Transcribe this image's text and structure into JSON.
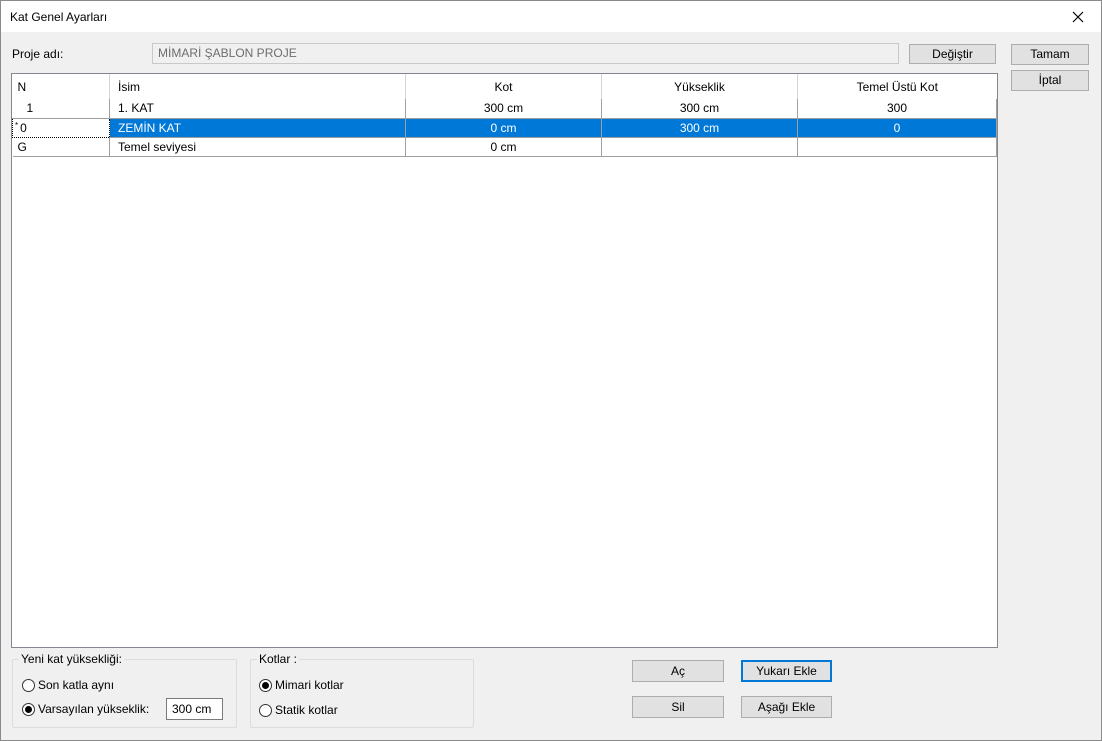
{
  "window": {
    "title": "Kat Genel Ayarları"
  },
  "project": {
    "label": "Proje adı:",
    "value": "MİMARİ ŞABLON PROJE",
    "change_button": "Değiştir"
  },
  "dialog_buttons": {
    "ok": "Tamam",
    "cancel": "İptal"
  },
  "table": {
    "headers": {
      "n": "N",
      "name": "İsim",
      "kot": "Kot",
      "height": "Yükseklik",
      "foundation": "Temel Üstü Kot"
    },
    "rows": [
      {
        "n": "1",
        "name": "1. KAT",
        "kot": "300 cm",
        "height": "300 cm",
        "foundation": "300"
      },
      {
        "n": "0",
        "name": "ZEMİN KAT",
        "kot": "0 cm",
        "height": "300 cm",
        "foundation": "0"
      },
      {
        "n": "G",
        "name": "Temel seviyesi",
        "kot": "0 cm",
        "height": "",
        "foundation": ""
      }
    ],
    "selected_row_marker": "*"
  },
  "new_floor_height": {
    "legend": "Yeni kat yüksekliği:",
    "option_same": "Son katla aynı",
    "option_default": "Varsayılan yükseklik:",
    "default_value": "300 cm",
    "selected": "default"
  },
  "levels": {
    "legend": "Kotlar :",
    "option_architectural": "Mimari kotlar",
    "option_static": "Statik kotlar",
    "selected": "architectural"
  },
  "actions": {
    "open": "Aç",
    "delete": "Sil",
    "add_above": "Yukarı Ekle",
    "add_below": "Aşağı Ekle"
  }
}
